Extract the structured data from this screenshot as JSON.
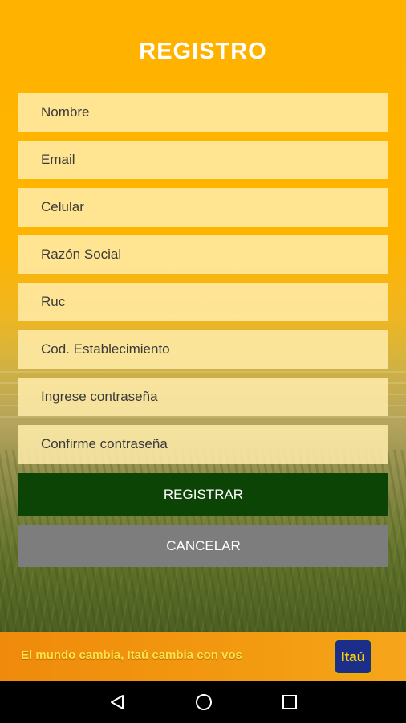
{
  "screen": {
    "title": "REGISTRO"
  },
  "form": {
    "fields": [
      {
        "placeholder": "Nombre"
      },
      {
        "placeholder": "Email"
      },
      {
        "placeholder": "Celular"
      },
      {
        "placeholder": "Razón Social"
      },
      {
        "placeholder": "Ruc"
      },
      {
        "placeholder": "Cod. Establecimiento"
      },
      {
        "placeholder": "Ingrese contraseña"
      },
      {
        "placeholder": "Confirme contraseña"
      }
    ],
    "register_label": "REGISTRAR",
    "cancel_label": "CANCELAR"
  },
  "banner": {
    "slogan": "El mundo cambia, Itaú cambia con vos",
    "logo_text": "Itaú"
  },
  "navbar": {
    "icons": [
      "back-icon",
      "home-icon",
      "recents-icon"
    ]
  },
  "colors": {
    "accent": "#ffb300",
    "register_button": "#0b4404",
    "cancel_button": "#7d7d7d"
  }
}
